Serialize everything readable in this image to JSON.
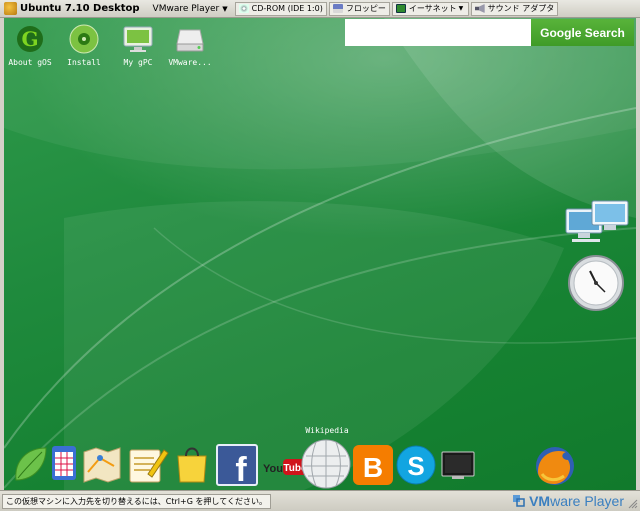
{
  "window": {
    "title": "Ubuntu 7.10 Desktop",
    "menu_label": "VMware Player",
    "devices": [
      {
        "label": "CD-ROM (IDE 1:0)"
      },
      {
        "label": "フロッピー"
      },
      {
        "label": "イーサネット"
      },
      {
        "label": "サウンド アダプタ"
      }
    ]
  },
  "desktop": {
    "icons": [
      {
        "label": "About gOS",
        "icon": "gos-logo-icon"
      },
      {
        "label": "Install",
        "icon": "install-disc-icon"
      },
      {
        "label": "My gPC",
        "icon": "monitor-icon"
      },
      {
        "label": "VMware...",
        "icon": "drive-icon"
      }
    ],
    "search": {
      "value": "",
      "button_label": "Google Search"
    },
    "gadgets": [
      "network-computers-icon",
      "clock-icon"
    ]
  },
  "dock": {
    "hover_label": "Wikipedia",
    "items": [
      {
        "name": "leaf-icon"
      },
      {
        "name": "spreadsheet-icon"
      },
      {
        "name": "maps-icon"
      },
      {
        "name": "document-editor-icon"
      },
      {
        "name": "shopping-bag-icon"
      },
      {
        "name": "facebook-icon",
        "text": "f"
      },
      {
        "name": "youtube-icon",
        "text": "You",
        "text2": "Tube"
      },
      {
        "name": "wikipedia-icon"
      },
      {
        "name": "blogger-icon",
        "text": "B"
      },
      {
        "name": "skype-icon",
        "text": "S"
      },
      {
        "name": "display-icon"
      },
      {
        "name": "firefox-icon"
      }
    ]
  },
  "status": {
    "hint": "この仮想マシンに入力先を切り替えるには、Ctrl+G を押してください。",
    "brand_prefix": "VM",
    "brand_suffix": "ware Player"
  },
  "colors": {
    "desktop_green": "#1f8a3d",
    "search_button": "#4ca631",
    "facebook_blue": "#3b5998",
    "blogger_orange": "#f57d00",
    "skype_blue": "#12a5e1"
  }
}
